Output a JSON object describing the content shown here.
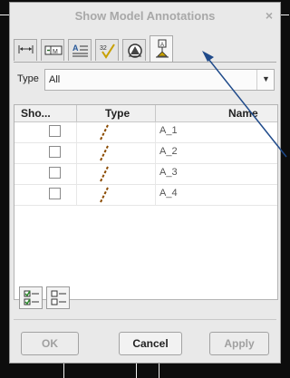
{
  "dialog": {
    "title": "Show Model Annotations",
    "close_glyph": "×"
  },
  "tabs": [
    {
      "icon": "dimensions-icon",
      "active": false
    },
    {
      "icon": "geometric-tolerance-icon",
      "active": false
    },
    {
      "icon": "notes-icon",
      "active": false
    },
    {
      "icon": "surface-finish-icon",
      "active": false
    },
    {
      "icon": "symbols-icon",
      "active": false
    },
    {
      "icon": "datum-target-icon",
      "active": true
    }
  ],
  "filter": {
    "label": "Type",
    "value": "All"
  },
  "table": {
    "headers": {
      "show": "Sho...",
      "type": "Type",
      "name": "Name"
    },
    "rows": [
      {
        "checked": false,
        "type_icon": "datum-axis-icon",
        "name": "A_1"
      },
      {
        "checked": false,
        "type_icon": "datum-axis-icon",
        "name": "A_2"
      },
      {
        "checked": false,
        "type_icon": "datum-axis-icon",
        "name": "A_3"
      },
      {
        "checked": false,
        "type_icon": "datum-axis-icon",
        "name": "A_4"
      }
    ]
  },
  "actions": {
    "select_all_icon": "select-all-icon",
    "deselect_all_icon": "deselect-all-icon"
  },
  "buttons": {
    "ok": "OK",
    "cancel": "Cancel",
    "apply": "Apply"
  },
  "colors": {
    "accent": "#c8a000",
    "callout_arrow": "#1f4a8a",
    "type_icon": "#8a4a00"
  }
}
